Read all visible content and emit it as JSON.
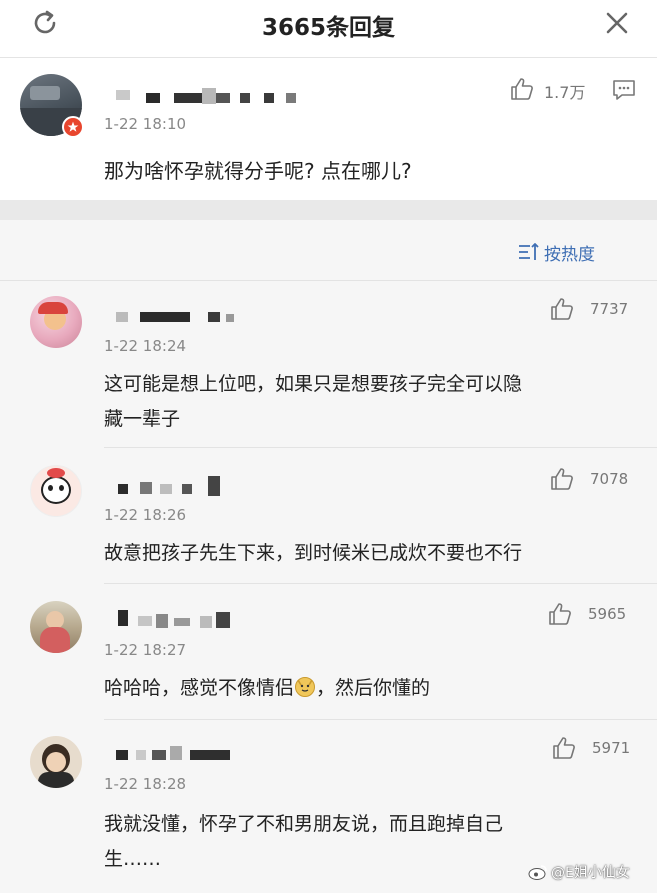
{
  "header": {
    "title": "3665条回复",
    "refresh_icon": "refresh-icon",
    "close_icon": "close-icon"
  },
  "main_comment": {
    "time": "1-22 18:10",
    "likes": "1.7万",
    "text": "那为啥怀孕就得分手呢? 点在哪儿?"
  },
  "sort": {
    "label": "按热度"
  },
  "replies": [
    {
      "time": "1-22 18:24",
      "likes": "7737",
      "text_line1": "这可能是想上位吧，如果只是想要孩子完全可以隐",
      "text_line2": "藏一辈子"
    },
    {
      "time": "1-22 18:26",
      "likes": "7078",
      "text_line1": "故意把孩子先生下来，到时候米已成炊不要也不行"
    },
    {
      "time": "1-22 18:27",
      "likes": "5965",
      "text_before_emoji": "哈哈哈，感觉不像情侣",
      "text_after_emoji": "，然后你懂的"
    },
    {
      "time": "1-22 18:28",
      "likes": "5971",
      "text_line1": "我就没懂，怀孕了不和男朋友说，而且跑掉自己",
      "text_line2": "生……"
    }
  ],
  "watermark": {
    "text": "@E姐小仙女"
  },
  "colors": {
    "accent": "#3f6fb4",
    "badge": "#e8462e"
  }
}
